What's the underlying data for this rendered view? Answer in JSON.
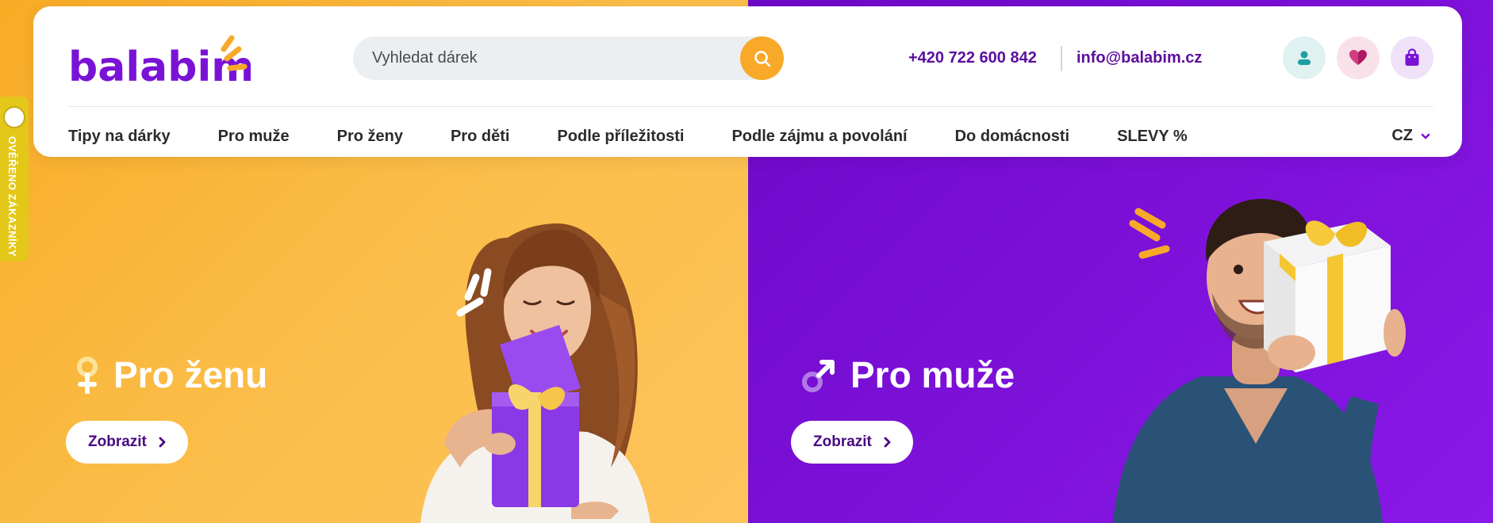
{
  "brand": {
    "name": "balabim",
    "accent": "#7a12d6",
    "logo_accent": "#f8a92a"
  },
  "search": {
    "placeholder": "Vyhledat dárek",
    "icon": "search-icon"
  },
  "contact": {
    "phone": "+420 722 600 842",
    "email": "info@balabim.cz"
  },
  "header_icons": [
    {
      "name": "user-icon",
      "color": "#1f9ea3"
    },
    {
      "name": "heart-icon",
      "color": "#b0185f"
    },
    {
      "name": "bag-icon",
      "color": "#7a12d6"
    }
  ],
  "nav": {
    "items": [
      {
        "label": "Tipy na dárky"
      },
      {
        "label": "Pro muže"
      },
      {
        "label": "Pro ženy"
      },
      {
        "label": "Pro děti"
      },
      {
        "label": "Podle příležitosti"
      },
      {
        "label": "Podle zájmu a povolání"
      },
      {
        "label": "Do domácnosti"
      },
      {
        "label": "SLEVY %"
      }
    ],
    "language": "CZ"
  },
  "verified_badge": {
    "label": "OVĚŘENO ZÁKAZNÍKY",
    "color": "#e3c81a"
  },
  "hero": {
    "left": {
      "title": "Pro ženu",
      "button": "Zobrazit",
      "background": "#f8ab25",
      "symbol": "female-symbol-icon"
    },
    "right": {
      "title": "Pro muže",
      "button": "Zobrazit",
      "background": "#7410d0",
      "symbol": "male-symbol-icon"
    }
  }
}
